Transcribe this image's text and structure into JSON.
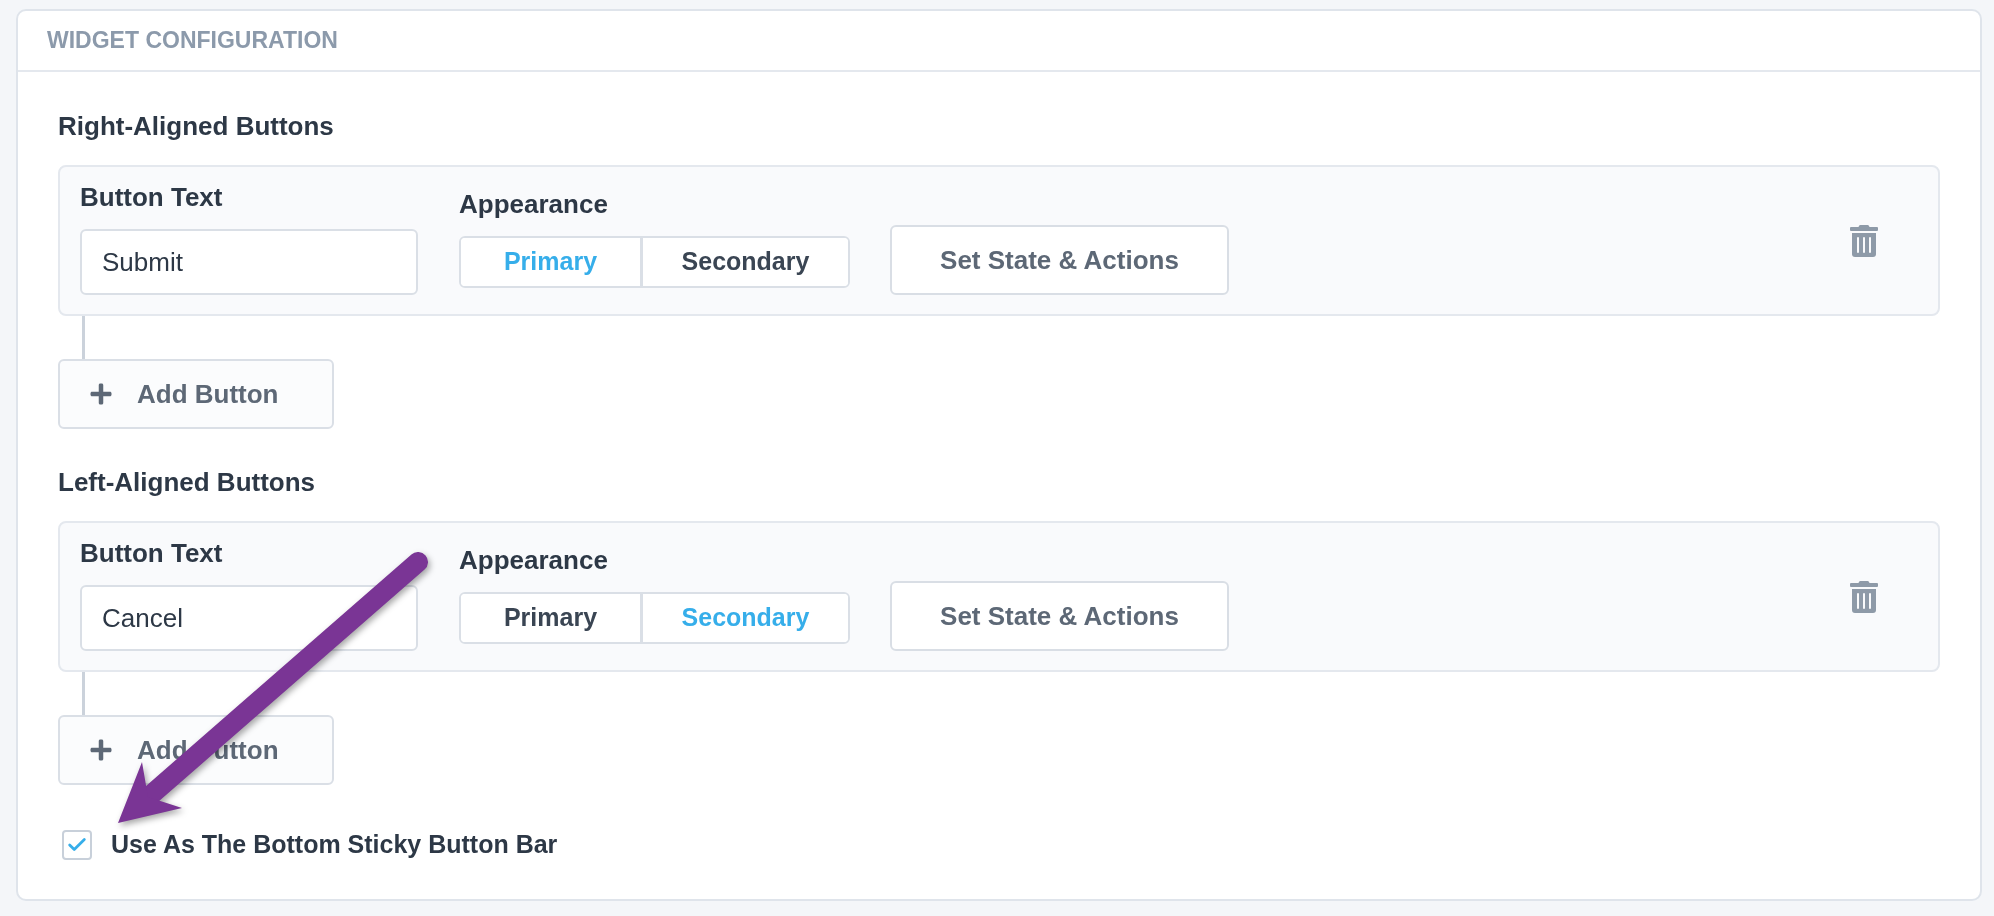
{
  "panel": {
    "title": "WIDGET CONFIGURATION"
  },
  "sections": [
    {
      "heading": "Right-Aligned Buttons",
      "rows": [
        {
          "text_label": "Button Text",
          "text_value": "Submit",
          "appearance_label": "Appearance",
          "appearance_options": [
            {
              "label": "Primary",
              "selected": true
            },
            {
              "label": "Secondary",
              "selected": false
            }
          ],
          "actions_button": "Set State & Actions"
        }
      ],
      "add_button": {
        "visible_text_parts": [
          "Add Button"
        ]
      }
    },
    {
      "heading": "Left-Aligned Buttons",
      "rows": [
        {
          "text_label": "Button Text",
          "text_value": "Cancel",
          "appearance_label": "Appearance",
          "appearance_options": [
            {
              "label": "Primary",
              "selected": false
            },
            {
              "label": "Secondary",
              "selected": true
            }
          ],
          "actions_button": "Set State & Actions"
        }
      ],
      "add_button": {
        "visible_text_parts": [
          "Add",
          "utton"
        ]
      }
    }
  ],
  "sticky_bar_option": {
    "label": "Use As The Bottom Sticky Button Bar",
    "checked": true
  }
}
